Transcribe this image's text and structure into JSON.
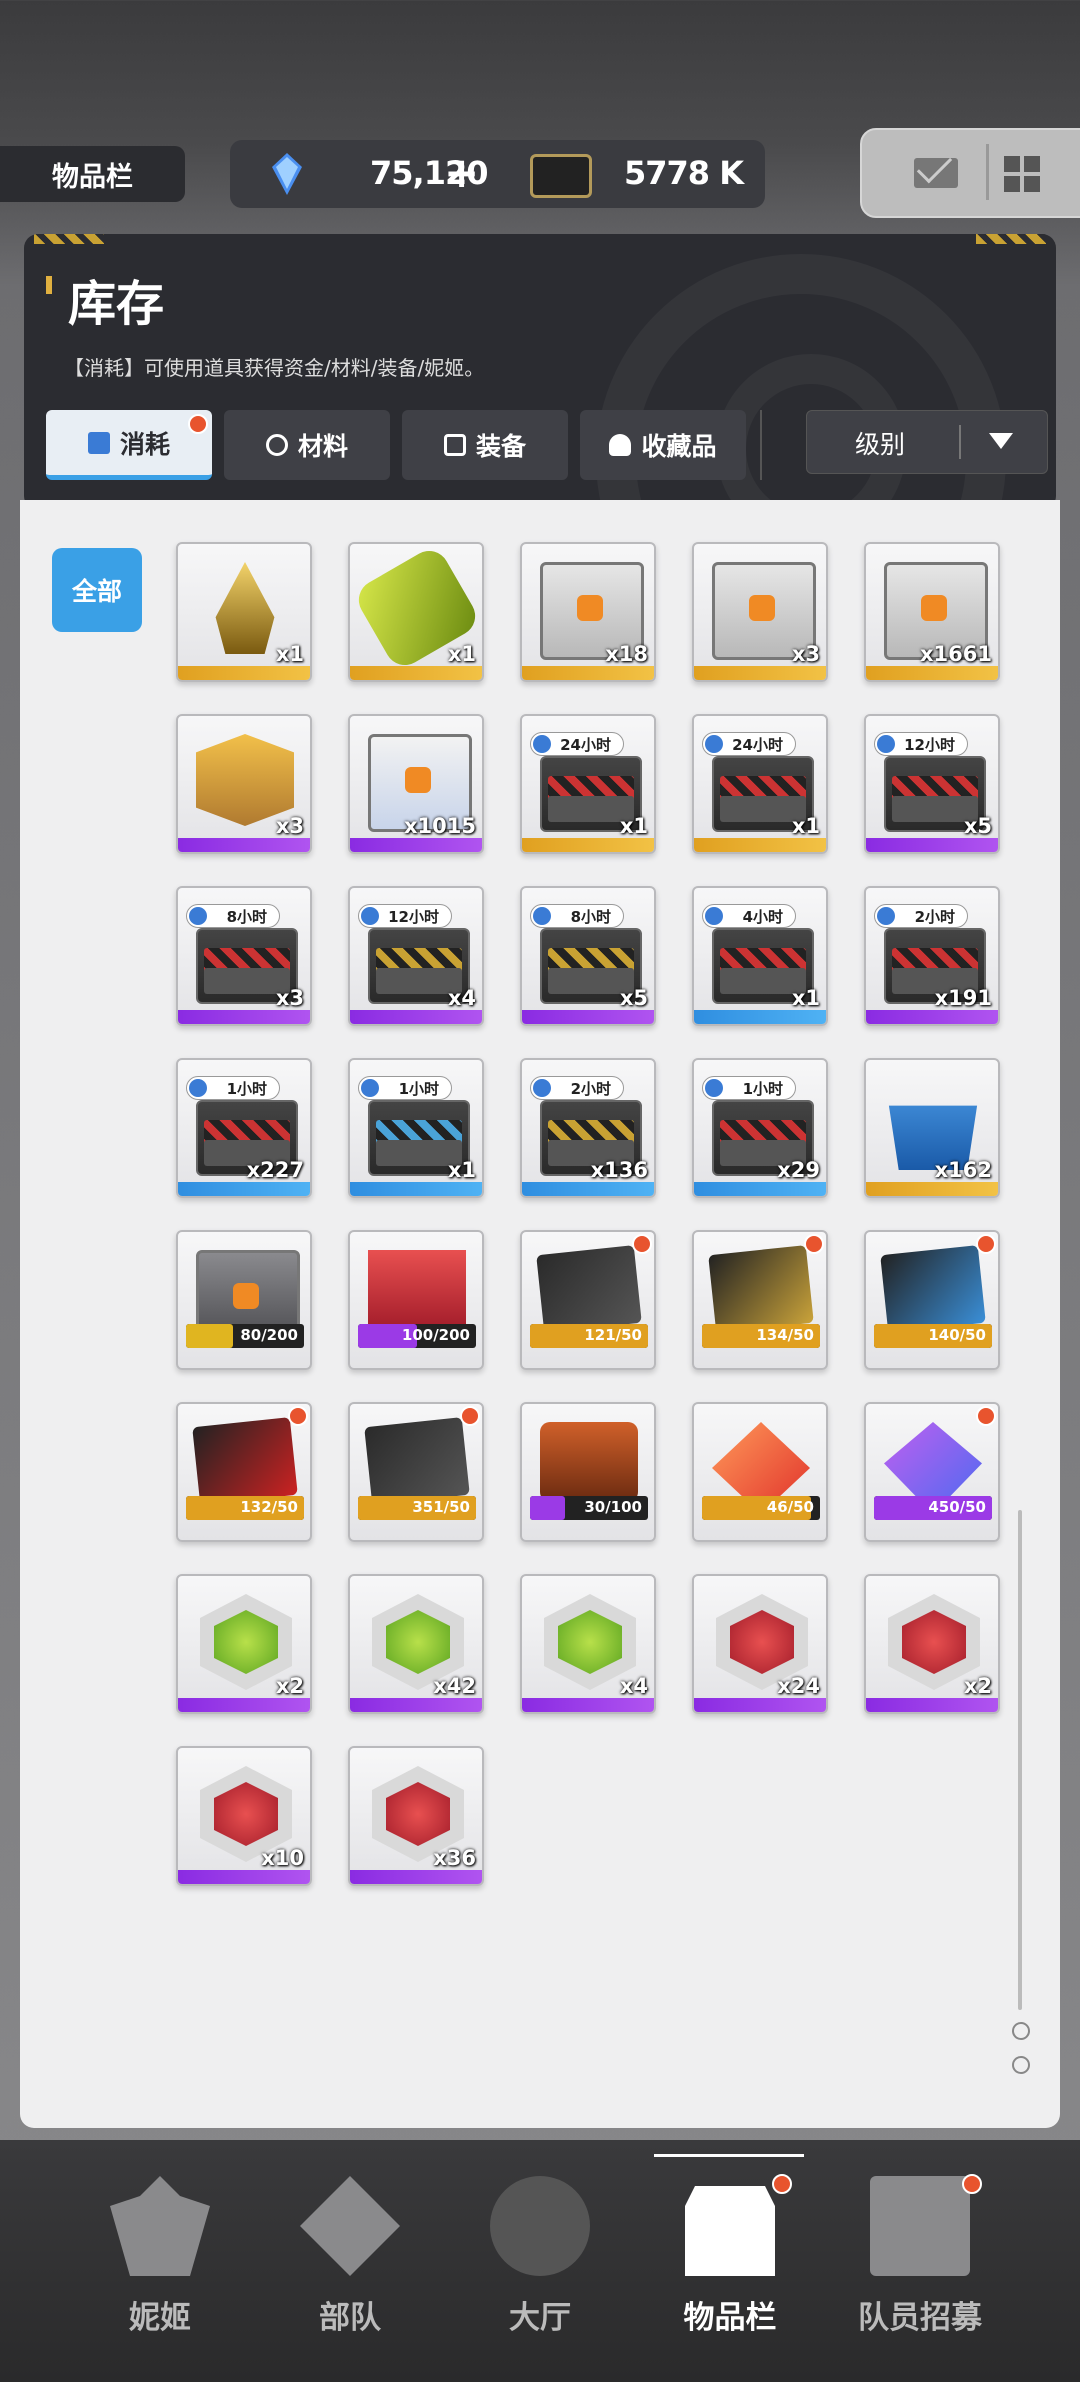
{
  "top": {
    "section_label": "物品栏",
    "crystal_value": "75,120",
    "add_label": "+",
    "credit_value": "5778 K"
  },
  "header": {
    "title": "库存",
    "description": "【消耗】可使用道具获得资金/材料/装备/妮姬。",
    "tabs": [
      {
        "label": "消耗",
        "active": true
      },
      {
        "label": "材料",
        "active": false
      },
      {
        "label": "装备",
        "active": false
      },
      {
        "label": "收藏品",
        "active": false
      }
    ],
    "sort_label": "级别"
  },
  "filter": {
    "label": "全部"
  },
  "items": [
    {
      "art": "trophy",
      "rarity": "gold",
      "count": "x1"
    },
    {
      "art": "capsule",
      "rarity": "gold",
      "count": "x1"
    },
    {
      "art": "crate",
      "rarity": "gold",
      "count": "x18"
    },
    {
      "art": "crate",
      "rarity": "gold",
      "count": "x3"
    },
    {
      "art": "crate",
      "rarity": "gold",
      "count": "x1661"
    },
    {
      "art": "box",
      "rarity": "purple",
      "count": "x3"
    },
    {
      "art": "crate-blue",
      "rarity": "purple",
      "count": "x1015"
    },
    {
      "art": "case",
      "rarity": "gold",
      "count": "x1",
      "time": "24小时"
    },
    {
      "art": "case",
      "rarity": "gold",
      "count": "x1",
      "time": "24小时"
    },
    {
      "art": "case",
      "rarity": "purple",
      "count": "x5",
      "time": "12小时"
    },
    {
      "art": "case",
      "rarity": "purple",
      "count": "x3",
      "time": "8小时"
    },
    {
      "art": "case-gold",
      "rarity": "purple",
      "count": "x4",
      "time": "12小时"
    },
    {
      "art": "case-gold",
      "rarity": "purple",
      "count": "x5",
      "time": "8小时"
    },
    {
      "art": "case",
      "rarity": "blue",
      "count": "x1",
      "time": "4小时"
    },
    {
      "art": "case",
      "rarity": "purple",
      "count": "x191",
      "time": "2小时"
    },
    {
      "art": "case",
      "rarity": "blue",
      "count": "x227",
      "time": "1小时"
    },
    {
      "art": "case-blue",
      "rarity": "blue",
      "count": "x1",
      "time": "1小时"
    },
    {
      "art": "case-gold",
      "rarity": "blue",
      "count": "x136",
      "time": "2小时"
    },
    {
      "art": "case",
      "rarity": "blue",
      "count": "x29",
      "time": "1小时"
    },
    {
      "art": "bin",
      "rarity": "gold",
      "count": "x162"
    },
    {
      "art": "crate-gray",
      "rarity": "none",
      "progress": "80/200",
      "fill": 0.4,
      "fillColor": "#e0b520"
    },
    {
      "art": "lucky",
      "rarity": "none",
      "progress": "100/200",
      "fill": 0.5,
      "fillColor": "#9b3ae6"
    },
    {
      "art": "card",
      "rarity": "none",
      "progress": "121/50",
      "fill": 1,
      "fillColor": "#e0a020",
      "dot": true
    },
    {
      "art": "card-gold",
      "rarity": "none",
      "progress": "134/50",
      "fill": 1,
      "fillColor": "#e0a020",
      "dot": true
    },
    {
      "art": "card-blue",
      "rarity": "none",
      "progress": "140/50",
      "fill": 1,
      "fillColor": "#e0a020",
      "dot": true
    },
    {
      "art": "card-red",
      "rarity": "none",
      "progress": "132/50",
      "fill": 1,
      "fillColor": "#e0a020",
      "dot": true
    },
    {
      "art": "card",
      "rarity": "none",
      "progress": "351/50",
      "fill": 1,
      "fillColor": "#e0a020",
      "dot": true
    },
    {
      "art": "vest",
      "rarity": "none",
      "progress": "30/100",
      "fill": 0.3,
      "fillColor": "#9b3ae6"
    },
    {
      "art": "ssr",
      "rarity": "none",
      "progress": "46/50",
      "fill": 0.92,
      "fillColor": "#e0a020"
    },
    {
      "art": "gem",
      "rarity": "none",
      "progress": "450/50",
      "fill": 1,
      "fillColor": "#9b3ae6",
      "dot": true
    },
    {
      "art": "hex-green",
      "rarity": "purple",
      "count": "x2"
    },
    {
      "art": "hex-green",
      "rarity": "purple",
      "count": "x42"
    },
    {
      "art": "hex-green",
      "rarity": "purple",
      "count": "x4"
    },
    {
      "art": "hex-red",
      "rarity": "purple",
      "count": "x24"
    },
    {
      "art": "hex-red",
      "rarity": "purple",
      "count": "x2"
    },
    {
      "art": "hex-red",
      "rarity": "purple",
      "count": "x10"
    },
    {
      "art": "hex-red",
      "rarity": "purple",
      "count": "x36"
    }
  ],
  "nav": [
    {
      "label": "妮姬",
      "icon": "nikke-icon",
      "active": false
    },
    {
      "label": "部队",
      "icon": "squad-icon",
      "active": false
    },
    {
      "label": "大厅",
      "icon": "lobby-icon",
      "active": false
    },
    {
      "label": "物品栏",
      "icon": "inventory-icon",
      "active": true
    },
    {
      "label": "队员招募",
      "icon": "recruit-icon",
      "active": false
    }
  ],
  "colors": {
    "accent": "#3aa0e6",
    "badge": "#e8542e",
    "panel": "#2b2c31"
  }
}
